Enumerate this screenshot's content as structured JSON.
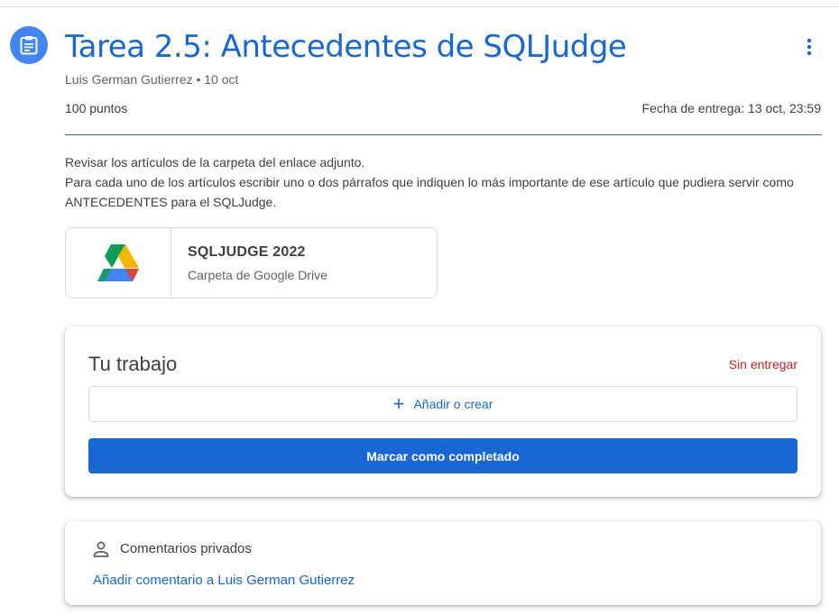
{
  "assignment": {
    "icon": "assignment-icon",
    "title": "Tarea 2.5: Antecedentes de SQLJudge",
    "meta": "Luis German Gutierrez • 10 oct",
    "points": "100 puntos",
    "due": "Fecha de entrega: 13 oct, 23:59",
    "more_icon": "more-vert-icon"
  },
  "description": {
    "line1": "Revisar los artículos de la carpeta del enlace adjunto.",
    "line2": "Para cada uno de los artículos escribir uno o dos párrafos que indiquen lo más importante de ese artículo que pudiera servir como ANTECEDENTES para el SQLJudge."
  },
  "attachment": {
    "icon": "google-drive-icon",
    "title": "SQLJUDGE 2022",
    "subtitle": "Carpeta de Google Drive"
  },
  "your_work": {
    "title": "Tu trabajo",
    "status": "Sin entregar",
    "add_icon": "plus-icon",
    "add_label": "Añadir o crear",
    "complete_label": "Marcar como completado"
  },
  "comments": {
    "icon": "person-icon",
    "title": "Comentarios privados",
    "add_link": "Añadir comentario a Luis German Gutierrez"
  },
  "colors": {
    "accent": "#1967d2",
    "icon_blue": "#4285f4",
    "status_red": "#c5221f",
    "divider_teal": "#33766a"
  }
}
